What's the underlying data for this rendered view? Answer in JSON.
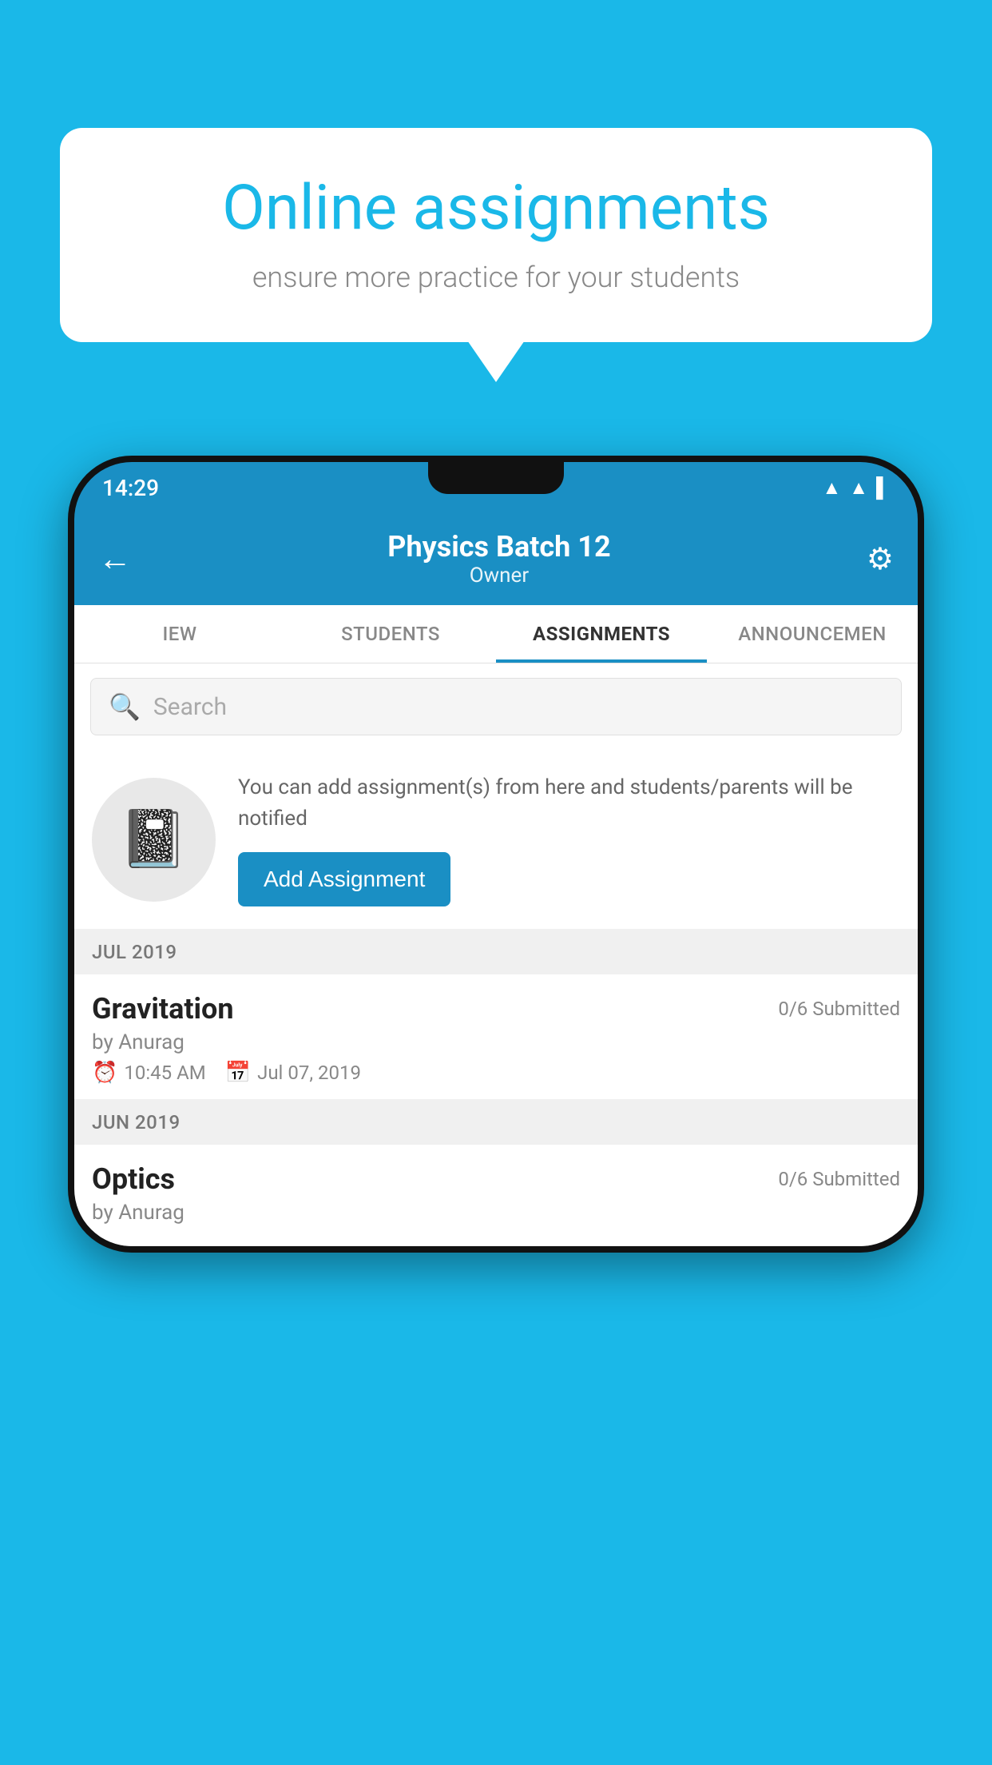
{
  "background_color": "#1ab8e8",
  "speech_bubble": {
    "title": "Online assignments",
    "subtitle": "ensure more practice for your students"
  },
  "phone": {
    "status_bar": {
      "time": "14:29"
    },
    "header": {
      "title": "Physics Batch 12",
      "subtitle": "Owner",
      "back_label": "←",
      "settings_label": "⚙"
    },
    "tabs": [
      {
        "label": "IEW",
        "active": false
      },
      {
        "label": "STUDENTS",
        "active": false
      },
      {
        "label": "ASSIGNMENTS",
        "active": true
      },
      {
        "label": "ANNOUNCEMEN",
        "active": false
      }
    ],
    "search": {
      "placeholder": "Search"
    },
    "promo": {
      "text": "You can add assignment(s) from here and students/parents will be notified",
      "button_label": "Add Assignment"
    },
    "sections": [
      {
        "label": "JUL 2019",
        "assignments": [
          {
            "name": "Gravitation",
            "status": "0/6 Submitted",
            "author": "by Anurag",
            "time": "10:45 AM",
            "date": "Jul 07, 2019"
          }
        ]
      },
      {
        "label": "JUN 2019",
        "assignments": [
          {
            "name": "Optics",
            "status": "0/6 Submitted",
            "author": "by Anurag",
            "time": "",
            "date": ""
          }
        ]
      }
    ]
  }
}
